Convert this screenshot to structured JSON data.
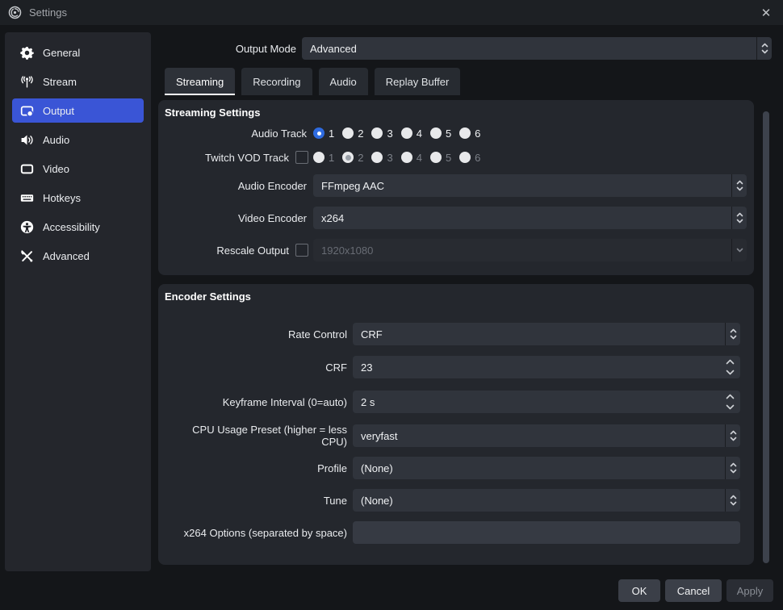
{
  "titlebar": {
    "title": "Settings",
    "close_glyph": "✕"
  },
  "sidebar": {
    "items": [
      {
        "label": "General"
      },
      {
        "label": "Stream"
      },
      {
        "label": "Output"
      },
      {
        "label": "Audio"
      },
      {
        "label": "Video"
      },
      {
        "label": "Hotkeys"
      },
      {
        "label": "Accessibility"
      },
      {
        "label": "Advanced"
      }
    ],
    "selected": "Output"
  },
  "header": {
    "output_mode_label": "Output Mode",
    "output_mode_value": "Advanced"
  },
  "tabs": [
    {
      "label": "Streaming"
    },
    {
      "label": "Recording"
    },
    {
      "label": "Audio"
    },
    {
      "label": "Replay Buffer"
    }
  ],
  "active_tab": "Streaming",
  "streaming": {
    "title": "Streaming Settings",
    "audio_track_label": "Audio Track",
    "audio_track_options": [
      "1",
      "2",
      "3",
      "4",
      "5",
      "6"
    ],
    "audio_track_selected": "1",
    "twitch_vod_label": "Twitch VOD Track",
    "twitch_vod_checked": false,
    "twitch_vod_options": [
      "1",
      "2",
      "3",
      "4",
      "5",
      "6"
    ],
    "twitch_vod_selected": "2",
    "audio_encoder_label": "Audio Encoder",
    "audio_encoder_value": "FFmpeg AAC",
    "video_encoder_label": "Video Encoder",
    "video_encoder_value": "x264",
    "rescale_label": "Rescale Output",
    "rescale_checked": false,
    "rescale_value": "1920x1080"
  },
  "encoder": {
    "title": "Encoder Settings",
    "rows": [
      {
        "label": "Rate Control",
        "value": "CRF"
      },
      {
        "label": "CRF",
        "value": "23"
      },
      {
        "label": "Keyframe Interval (0=auto)",
        "value": "2 s"
      },
      {
        "label": "CPU Usage Preset (higher = less CPU)",
        "value": "veryfast"
      },
      {
        "label": "Profile",
        "value": "(None)"
      },
      {
        "label": "Tune",
        "value": "(None)"
      },
      {
        "label": "x264 Options (separated by space)",
        "value": ""
      }
    ]
  },
  "footer": {
    "ok": "OK",
    "cancel": "Cancel",
    "apply": "Apply"
  },
  "colors": {
    "accent": "#3a55d6",
    "radio_accent": "#2e6be0",
    "panel": "#24272d",
    "field": "#30343c"
  }
}
